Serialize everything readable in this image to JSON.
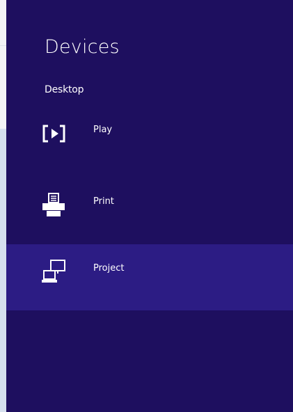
{
  "charm": {
    "title": "Devices",
    "subtitle": "Desktop",
    "items": [
      {
        "label": "Play",
        "icon": "play-icon",
        "selected": false
      },
      {
        "label": "Print",
        "icon": "printer-icon",
        "selected": false
      },
      {
        "label": "Project",
        "icon": "project-icon",
        "selected": true
      }
    ]
  },
  "colors": {
    "background": "#1e0f5f",
    "selected_background": "#2c1c84",
    "text": "#ffffff",
    "left_strip": "#f3f4f6",
    "left_strip_accent": "#d6e0ee"
  }
}
